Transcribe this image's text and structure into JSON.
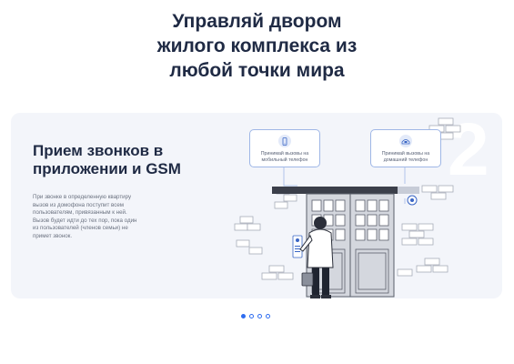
{
  "headline": {
    "line1": "Управляй двором",
    "line2": "жилого комплекса из",
    "line3": "любой точки мира"
  },
  "slide": {
    "title_line1": "Прием звонков в",
    "title_line2": "приложении и GSM",
    "description_lines": [
      "При звонке в определенную квартиру",
      "вызов из домофона поступит всем",
      "пользователям, привязанным к ней.",
      "Вызов будет идти до тех пор, пока один",
      "из пользователей (членов семьи) не",
      "примет звонок."
    ],
    "number": "2",
    "bubbles": [
      {
        "icon": "mobile-phone-icon",
        "line1": "Принимай вызовы на",
        "line2": "мобильный телефон"
      },
      {
        "icon": "home-phone-icon",
        "line1": "Принимай вызовы на",
        "line2": "домашний телефон"
      }
    ]
  },
  "carousel": {
    "total": 4,
    "active_index": 0
  },
  "colors": {
    "heading": "#1f2a44",
    "card_bg": "#f3f5fa",
    "accent": "#2f6df0",
    "line": "#9fb7e6"
  }
}
